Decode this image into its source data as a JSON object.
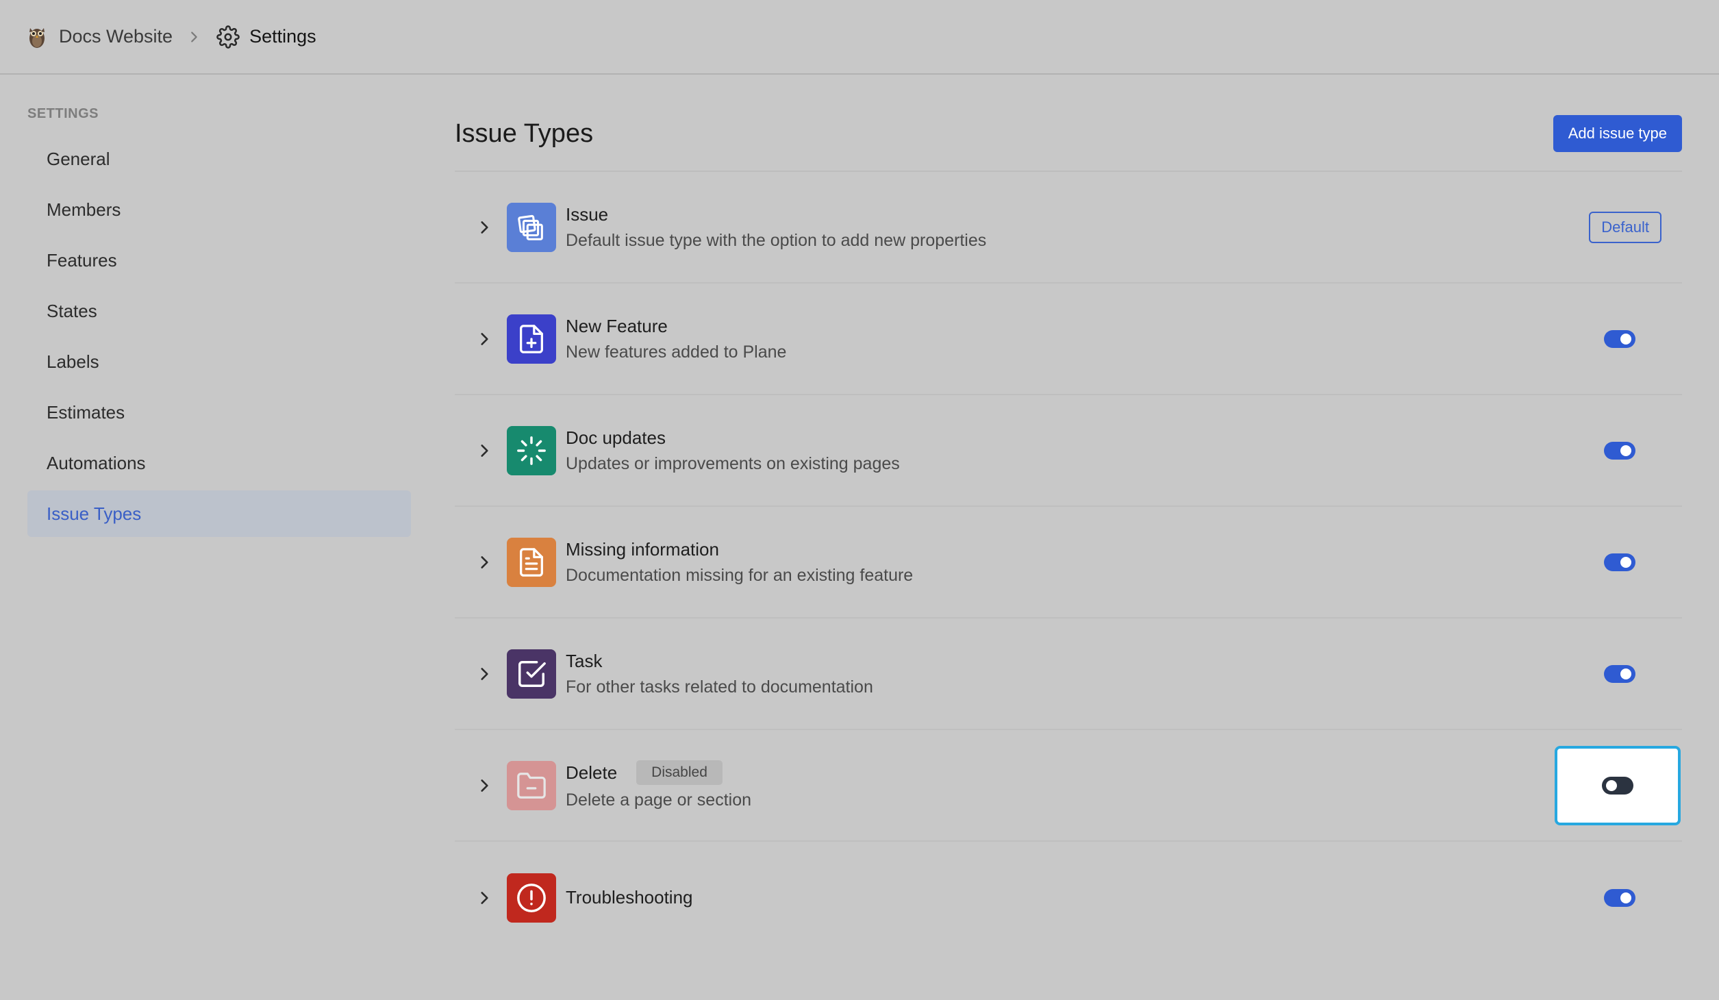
{
  "breadcrumb": {
    "project": "Docs Website",
    "current": "Settings"
  },
  "sidebar": {
    "heading": "SETTINGS",
    "items": [
      {
        "label": "General"
      },
      {
        "label": "Members"
      },
      {
        "label": "Features"
      },
      {
        "label": "States"
      },
      {
        "label": "Labels"
      },
      {
        "label": "Estimates"
      },
      {
        "label": "Automations"
      },
      {
        "label": "Issue Types",
        "active": true
      }
    ]
  },
  "main": {
    "title": "Issue Types",
    "add_button": "Add issue type",
    "default_badge": "Default",
    "disabled_badge": "Disabled",
    "rows": [
      {
        "title": "Issue",
        "description": "Default issue type with the option to add new properties",
        "icon": "stack-icon",
        "color": "#5a7fd6",
        "right": "default"
      },
      {
        "title": "New Feature",
        "description": "New features added to Plane",
        "icon": "file-plus-icon",
        "color": "#3b40c9",
        "right": "toggle-on"
      },
      {
        "title": "Doc updates",
        "description": "Updates or improvements on existing pages",
        "icon": "loader-icon",
        "color": "#178a6e",
        "right": "toggle-on"
      },
      {
        "title": "Missing information",
        "description": "Documentation missing for an existing feature",
        "icon": "file-text-icon",
        "color": "#d9813f",
        "right": "toggle-on"
      },
      {
        "title": "Task",
        "description": "For other tasks related to documentation",
        "icon": "check-square-icon",
        "color": "#4a3466",
        "right": "toggle-on"
      },
      {
        "title": "Delete",
        "description": "Delete a page or section",
        "icon": "folder-minus-icon",
        "color": "#e06a6a",
        "right": "toggle-off",
        "disabled": true
      },
      {
        "title": "Troubleshooting",
        "description": "",
        "icon": "alert-circle-icon",
        "color": "#c0281e",
        "right": "toggle-on"
      }
    ]
  },
  "colors": {
    "accent": "#2f5bd2",
    "focus_ring": "#27a8e0",
    "background": "#c8c8c8"
  }
}
